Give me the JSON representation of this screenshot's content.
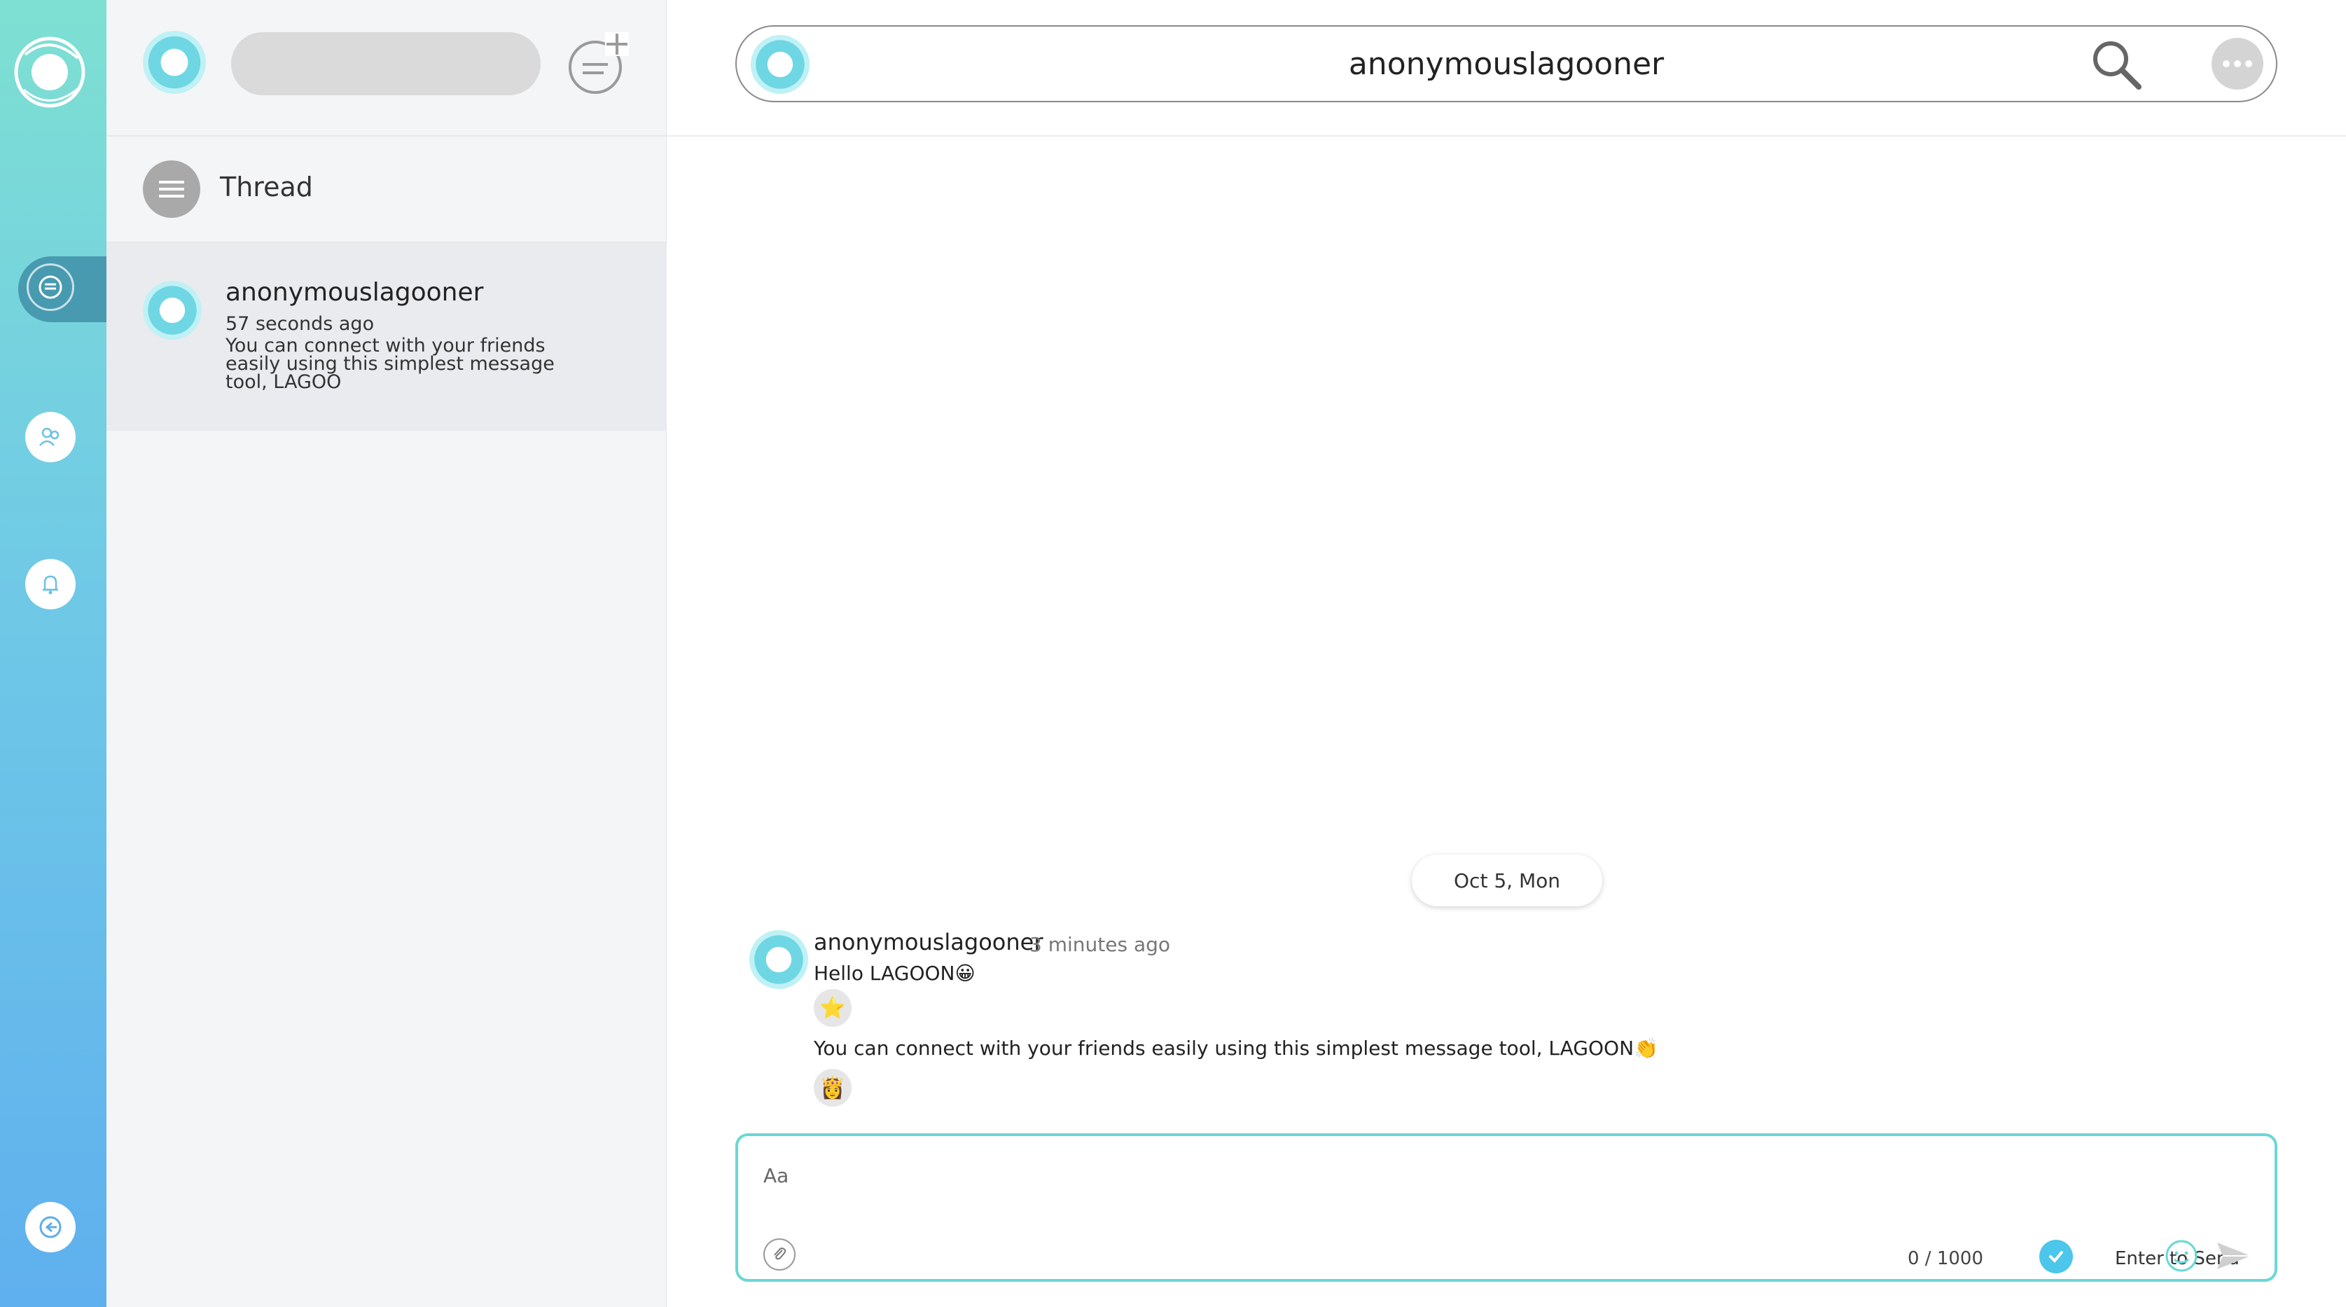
{
  "sidebar_panel": {
    "thread_label": "Thread",
    "conversation": {
      "name": "anonymouslagooner",
      "time": "57 seconds ago",
      "snippet": "You can connect with your friends easily using this simplest message tool, LAGOO"
    }
  },
  "header": {
    "title": "anonymouslagooner"
  },
  "chat": {
    "date_separator": "Oct 5, Mon",
    "sender": "anonymouslagooner",
    "time": "3 minutes ago",
    "messages": [
      {
        "text": "Hello LAGOON😀",
        "reaction": "⭐"
      },
      {
        "text": "You can connect with your friends easily using this simplest message tool, LAGOON👏",
        "reaction": "👸"
      }
    ]
  },
  "composer": {
    "placeholder": "Aa",
    "counter": "0 / 1000",
    "enter_label": "Enter to Send"
  },
  "icons": {
    "rail": [
      "lagoon-logo-icon",
      "chat-icon",
      "friends-icon",
      "bell-icon",
      "logout-icon"
    ],
    "accent": "#69d8d6",
    "check_color": "#4cc6ea"
  }
}
